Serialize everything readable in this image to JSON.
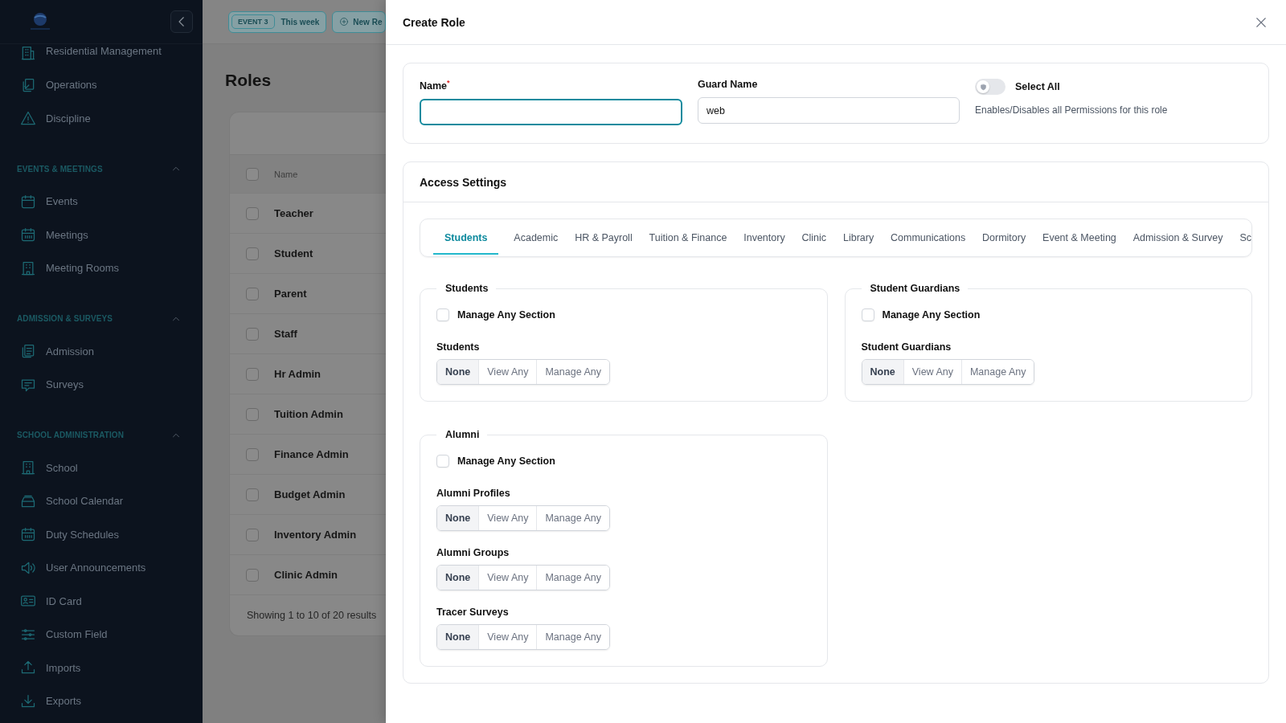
{
  "sidebar": {
    "top_items": [
      {
        "label": "Residential Management"
      },
      {
        "label": "Operations"
      },
      {
        "label": "Discipline"
      }
    ],
    "sections": [
      {
        "title": "EVENTS & MEETINGS",
        "expanded": true,
        "items": [
          {
            "label": "Events"
          },
          {
            "label": "Meetings"
          },
          {
            "label": "Meeting Rooms"
          }
        ]
      },
      {
        "title": "ADMISSION & SURVEYS",
        "expanded": true,
        "items": [
          {
            "label": "Admission"
          },
          {
            "label": "Surveys"
          }
        ]
      },
      {
        "title": "SCHOOL ADMINISTRATION",
        "expanded": true,
        "items": [
          {
            "label": "School"
          },
          {
            "label": "School Calendar"
          },
          {
            "label": "Duty Schedules"
          },
          {
            "label": "User Announcements"
          },
          {
            "label": "ID Card"
          },
          {
            "label": "Custom Field"
          },
          {
            "label": "Imports"
          },
          {
            "label": "Exports"
          }
        ]
      }
    ]
  },
  "top_bar": {
    "event_badge": "EVENT 3",
    "event_chip": "This week",
    "new_chip": "New Re"
  },
  "roles": {
    "title": "Roles",
    "columns": [
      "Name"
    ],
    "header_checked": false,
    "rows": [
      {
        "name": "Teacher",
        "checked": false
      },
      {
        "name": "Student",
        "checked": false
      },
      {
        "name": "Parent",
        "checked": false
      },
      {
        "name": "Staff",
        "checked": false
      },
      {
        "name": "Hr Admin",
        "checked": false
      },
      {
        "name": "Tuition Admin",
        "checked": false
      },
      {
        "name": "Finance Admin",
        "checked": false
      },
      {
        "name": "Budget Admin",
        "checked": false
      },
      {
        "name": "Inventory Admin",
        "checked": false
      },
      {
        "name": "Clinic Admin",
        "checked": false
      }
    ],
    "footer": "Showing 1 to 10 of 20 results"
  },
  "drawer": {
    "title": "Create Role",
    "name_field": {
      "label": "Name",
      "required_mark": "*",
      "focused": true
    },
    "guard_field": {
      "label": "Guard Name",
      "value": "web"
    },
    "select_all": {
      "label": "Select All",
      "on": false,
      "description": "Enables/Disables all Permissions for this role"
    },
    "access_title": "Access Settings",
    "tabs": [
      {
        "label": "Students",
        "selected": true
      },
      {
        "label": "Academic",
        "selected": false
      },
      {
        "label": "HR & Payroll",
        "selected": false
      },
      {
        "label": "Tuition & Finance",
        "selected": false
      },
      {
        "label": "Inventory",
        "selected": false
      },
      {
        "label": "Clinic",
        "selected": false
      },
      {
        "label": "Library",
        "selected": false
      },
      {
        "label": "Communications",
        "selected": false
      },
      {
        "label": "Dormitory",
        "selected": false
      },
      {
        "label": "Event & Meeting",
        "selected": false
      },
      {
        "label": "Admission & Survey",
        "selected": false
      },
      {
        "label": "Sc",
        "selected": false
      }
    ],
    "permission_groups": [
      {
        "title": "Students",
        "manage_any": {
          "label": "Manage Any Section",
          "checked": false
        },
        "permissions": [
          {
            "label": "Students",
            "options": [
              {
                "label": "None",
                "selected": true
              },
              {
                "label": "View Any",
                "selected": false
              },
              {
                "label": "Manage Any",
                "selected": false
              }
            ]
          }
        ]
      },
      {
        "title": "Student Guardians",
        "manage_any": {
          "label": "Manage Any Section",
          "checked": false
        },
        "permissions": [
          {
            "label": "Student Guardians",
            "options": [
              {
                "label": "None",
                "selected": true
              },
              {
                "label": "View Any",
                "selected": false
              },
              {
                "label": "Manage Any",
                "selected": false
              }
            ]
          }
        ]
      },
      {
        "title": "Alumni",
        "manage_any": {
          "label": "Manage Any Section",
          "checked": false
        },
        "permissions": [
          {
            "label": "Alumni Profiles",
            "options": [
              {
                "label": "None",
                "selected": true
              },
              {
                "label": "View Any",
                "selected": false
              },
              {
                "label": "Manage Any",
                "selected": false
              }
            ]
          },
          {
            "label": "Alumni Groups",
            "options": [
              {
                "label": "None",
                "selected": true
              },
              {
                "label": "View Any",
                "selected": false
              },
              {
                "label": "Manage Any",
                "selected": false
              }
            ]
          },
          {
            "label": "Tracer Surveys",
            "options": [
              {
                "label": "None",
                "selected": true
              },
              {
                "label": "View Any",
                "selected": false
              },
              {
                "label": "Manage Any",
                "selected": false
              }
            ]
          }
        ]
      }
    ]
  }
}
